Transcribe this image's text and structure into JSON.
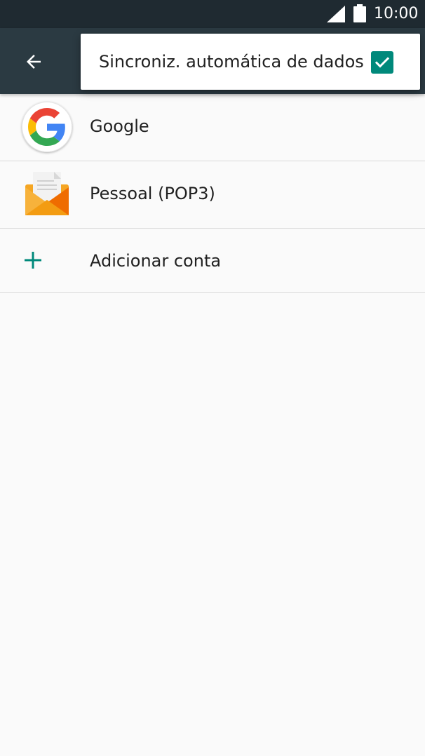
{
  "status_bar": {
    "time": "10:00",
    "signal_icon": "cell-signal-icon",
    "battery_icon": "battery-icon"
  },
  "app_bar": {
    "back_icon": "arrow-back-icon",
    "background_color": "#2b3a42"
  },
  "accounts": [
    {
      "label": "Google",
      "icon": "google-icon"
    },
    {
      "label": "Pessoal (POP3)",
      "icon": "email-envelope-icon"
    }
  ],
  "add_account": {
    "label": "Adicionar conta",
    "icon": "plus-icon",
    "accent_color": "#00897b"
  },
  "overflow_menu": {
    "items": [
      {
        "label": "Sincroniz. automática de dados",
        "checked": true
      }
    ],
    "checkbox_color": "#00897b"
  }
}
